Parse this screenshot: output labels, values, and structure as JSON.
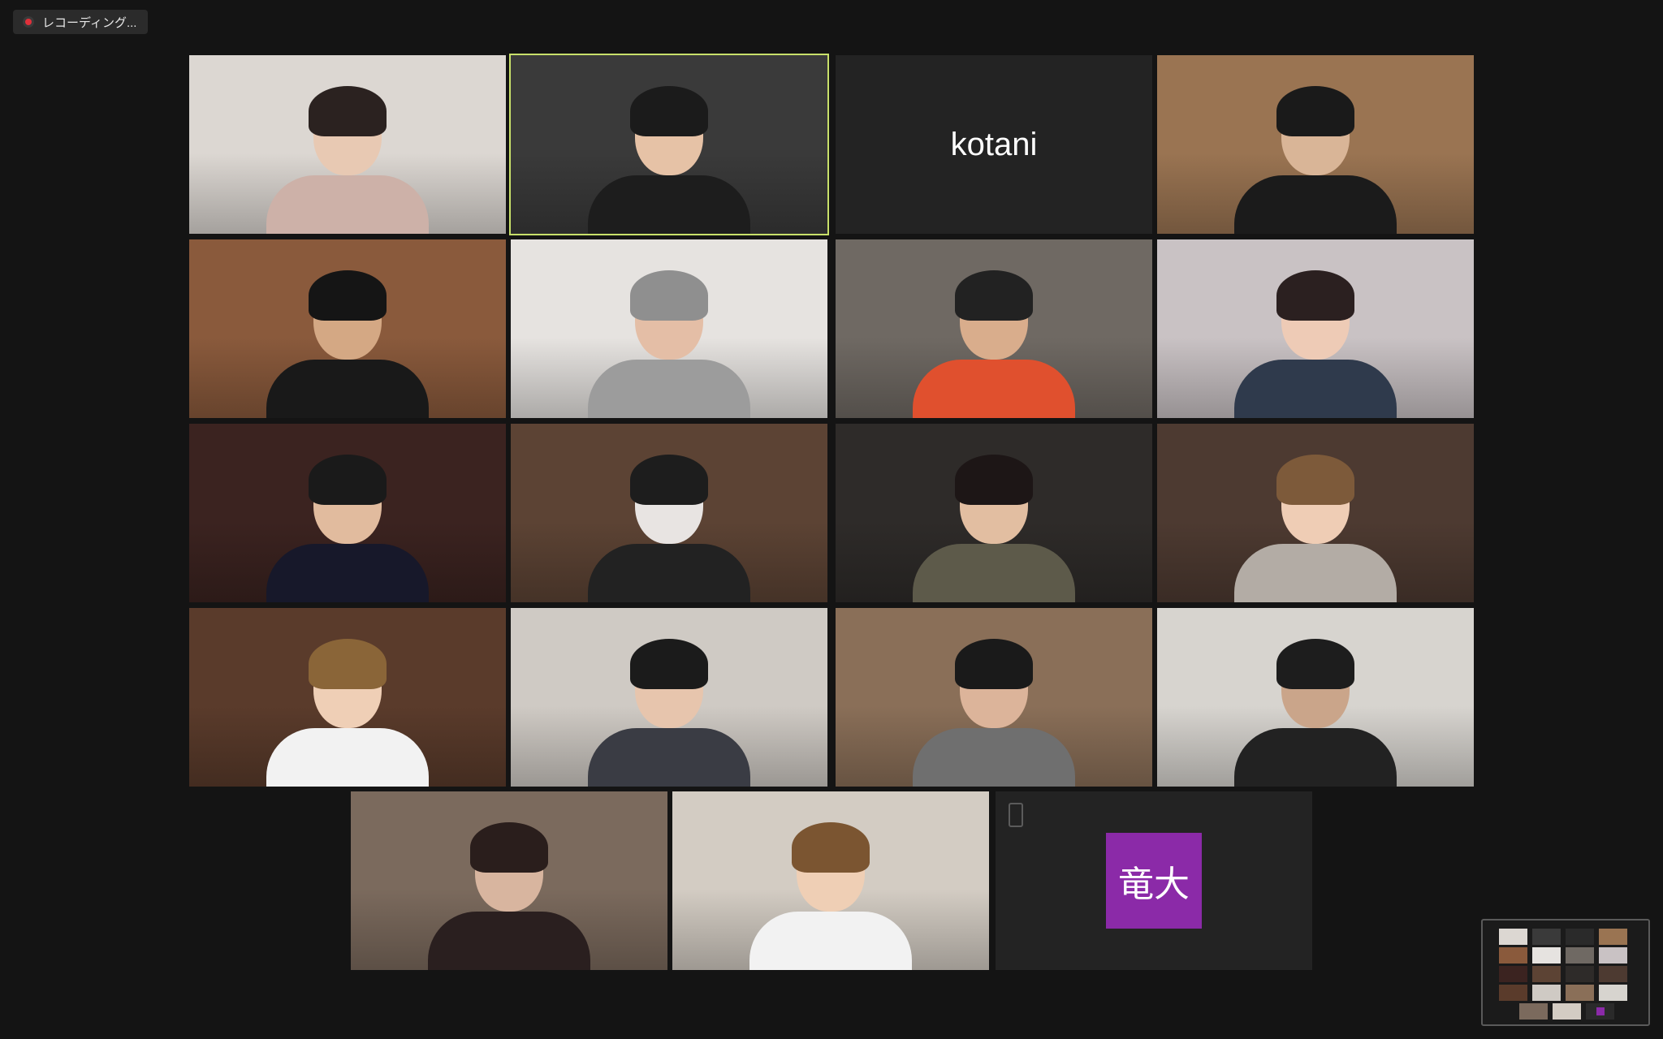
{
  "recording": {
    "label": "レコーディング..."
  },
  "gallery": {
    "tiles": [
      {
        "id": "r1c1",
        "kind": "video",
        "bg": "#dcd7d2",
        "skin": "#e8c9b3",
        "hair": "#2b2220",
        "shirt": "#cdb1a8"
      },
      {
        "id": "r1c2",
        "kind": "video",
        "active": true,
        "bg": "#3a3a3a",
        "skin": "#e6c2a6",
        "hair": "#1b1b1b",
        "shirt": "#1d1d1d"
      },
      {
        "id": "r1c3",
        "kind": "name",
        "name": "kotani"
      },
      {
        "id": "r1c4",
        "kind": "video",
        "bg": "#9a7452",
        "skin": "#d9b597",
        "hair": "#1a1a1a",
        "shirt": "#1b1b1b"
      },
      {
        "id": "r2c1",
        "kind": "video",
        "bg": "#8a5a3c",
        "skin": "#d4a884",
        "hair": "#151515",
        "shirt": "#191919"
      },
      {
        "id": "r2c2",
        "kind": "video",
        "bg": "#e6e3e0",
        "skin": "#e4bea6",
        "hair": "#8f8f8f",
        "shirt": "#9c9c9c"
      },
      {
        "id": "r2c3",
        "kind": "video",
        "bg": "#6f6963",
        "skin": "#d9ad8c",
        "hair": "#222222",
        "shirt": "#e0502e"
      },
      {
        "id": "r2c4",
        "kind": "video",
        "bg": "#c9c2c4",
        "skin": "#eecbb6",
        "hair": "#2b2020",
        "shirt": "#2f3a4c"
      },
      {
        "id": "r3c1",
        "kind": "video",
        "bg": "#3b2320",
        "skin": "#e1bb9e",
        "hair": "#1a1a1a",
        "shirt": "#17182a"
      },
      {
        "id": "r3c2",
        "kind": "video",
        "bg": "#5c4334",
        "skin": "#e8e4e2",
        "hair": "#1d1d1d",
        "shirt": "#222222"
      },
      {
        "id": "r3c3",
        "kind": "video",
        "bg": "#2e2b29",
        "skin": "#e2bea1",
        "hair": "#1d1616",
        "shirt": "#5d5a4a"
      },
      {
        "id": "r3c4",
        "kind": "video",
        "bg": "#4d3a31",
        "skin": "#efcdb5",
        "hair": "#7d5a3a",
        "shirt": "#b3aca5"
      },
      {
        "id": "r4c1",
        "kind": "video",
        "bg": "#5a3b2b",
        "skin": "#efcfb6",
        "hair": "#8a6538",
        "shirt": "#f2f2f2"
      },
      {
        "id": "r4c2",
        "kind": "video",
        "bg": "#cfcac4",
        "skin": "#e7c5ad",
        "hair": "#1b1b1b",
        "shirt": "#3a3c44"
      },
      {
        "id": "r4c3",
        "kind": "video",
        "bg": "#8a6f58",
        "skin": "#dcb49a",
        "hair": "#1a1a1a",
        "shirt": "#6f6f6f"
      },
      {
        "id": "r4c4",
        "kind": "video",
        "bg": "#d7d4cf",
        "skin": "#caa58a",
        "hair": "#1d1d1d",
        "shirt": "#222222"
      },
      {
        "id": "r5c1",
        "kind": "video",
        "bg": "#7b6a5d",
        "skin": "#d8b59f",
        "hair": "#2a1e1c",
        "shirt": "#2a1f1f"
      },
      {
        "id": "r5c2",
        "kind": "video",
        "bg": "#d3ccc3",
        "skin": "#efcfb5",
        "hair": "#7b5531",
        "shirt": "#f2f2f2"
      },
      {
        "id": "r5c3",
        "kind": "avatar",
        "initials": "竜大",
        "avatar_color": "#8b2aa8"
      }
    ]
  }
}
